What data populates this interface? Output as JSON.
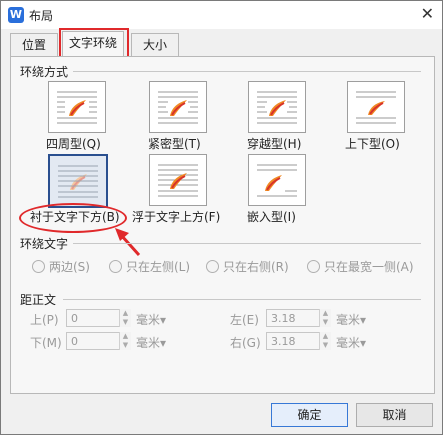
{
  "window": {
    "title": "布局"
  },
  "tabs": [
    {
      "label": "位置"
    },
    {
      "label": "文字环绕"
    },
    {
      "label": "大小"
    }
  ],
  "wrap_section": {
    "title": "环绕方式",
    "options": [
      {
        "label": "四周型(Q)"
      },
      {
        "label": "紧密型(T)"
      },
      {
        "label": "穿越型(H)"
      },
      {
        "label": "上下型(O)"
      },
      {
        "label": "衬于文字下方(B)"
      },
      {
        "label": "浮于文字上方(F)"
      },
      {
        "label": "嵌入型(I)"
      }
    ],
    "selected": "衬于文字下方(B)"
  },
  "wrap_text": {
    "title": "环绕文字",
    "options": [
      "两边(S)",
      "只在左侧(L)",
      "只在右侧(R)",
      "只在最宽一侧(A)"
    ]
  },
  "distance": {
    "title": "距正文",
    "top": {
      "label": "上(P)",
      "value": "0",
      "unit": "毫米▾"
    },
    "bottom": {
      "label": "下(M)",
      "value": "0",
      "unit": "毫米▾"
    },
    "left": {
      "label": "左(E)",
      "value": "3.18",
      "unit": "毫米▾"
    },
    "right": {
      "label": "右(G)",
      "value": "3.18",
      "unit": "毫米▾"
    }
  },
  "buttons": {
    "ok": "确定",
    "cancel": "取消"
  },
  "colors": {
    "accent": "#2a6fdb",
    "highlight": "#e0292b"
  }
}
